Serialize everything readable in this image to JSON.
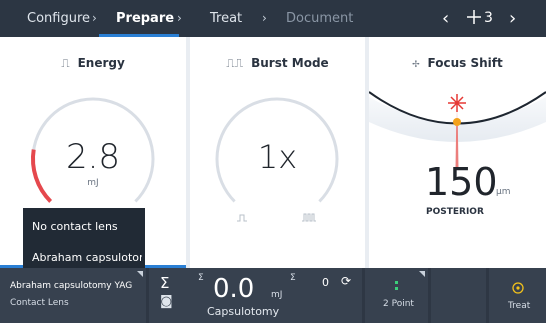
{
  "workflow": {
    "steps": [
      {
        "label": "Configure"
      },
      {
        "label": "Prepare"
      },
      {
        "label": "Treat"
      },
      {
        "label": "Document"
      }
    ],
    "nav": {
      "prev": "‹",
      "count": "3",
      "next": "›"
    }
  },
  "energy": {
    "title": "Energy",
    "value": "2.8",
    "unit": "mJ",
    "level": 0.2
  },
  "burst": {
    "title": "Burst Mode",
    "value": "1x",
    "unit": "",
    "level": 0.0
  },
  "focus": {
    "title": "Focus Shift",
    "value": "150",
    "unit": "µm",
    "label": "POSTERIOR"
  },
  "lens_menu": {
    "options": [
      "No contact lens",
      "Abraham capsulotom..."
    ]
  },
  "bottom": {
    "lens_name": "Abraham capsulotomy YAG",
    "lens_label": "Contact Lens",
    "total_energy": "0.0",
    "total_unit": "mJ",
    "shot_count": "0",
    "procedure": "Capsulotomy",
    "sigma1": "Σ",
    "sigma2": "Σ",
    "point_mode": "2 Point",
    "treat_label": "Treat"
  },
  "colors": {
    "accent": "#2a7fd4",
    "energy_arc": "#e5484d",
    "focus_dot": "#f3a21b",
    "laser": "#e53935"
  }
}
